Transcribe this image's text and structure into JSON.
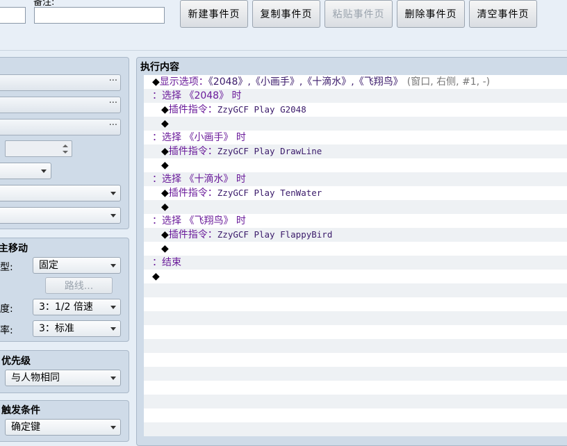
{
  "header": {
    "note_label": "备注:",
    "name_value": "",
    "note_value": "",
    "buttons": {
      "new_page": "新建事件页",
      "copy_page": "复制事件页",
      "paste_page": "粘贴事件页",
      "delete_page": "删除事件页",
      "clear_page": "清空事件页"
    }
  },
  "left": {
    "autonomous_movement": {
      "title": "主移动",
      "type_label": "型:",
      "type_value": "固定",
      "route_button": "路线...",
      "speed_label": "度:",
      "speed_value": "3：1/2 倍速",
      "freq_label": "率:",
      "freq_value": "3：标准"
    },
    "priority": {
      "title": "优先级",
      "value": "与人物相同"
    },
    "trigger": {
      "title": "触发条件",
      "value": "确定键"
    }
  },
  "content": {
    "title": "执行内容",
    "rows": [
      {
        "marker": "◆",
        "cmd": "显示选项：",
        "args": "《2048》,《小画手》,《十滴水》,《飞翔鸟》",
        "extra": "(窗口, 右侧, #1, -)"
      },
      {
        "marker": "：",
        "cmd": "选择 《2048》 时"
      },
      {
        "marker": "◆",
        "cmd": "插件指令：",
        "args": "ZzyGCF Play G2048"
      },
      {
        "marker": "◆"
      },
      {
        "marker": "：",
        "cmd": "选择 《小画手》 时"
      },
      {
        "marker": "◆",
        "cmd": "插件指令：",
        "args": "ZzyGCF Play DrawLine"
      },
      {
        "marker": "◆"
      },
      {
        "marker": "：",
        "cmd": "选择 《十滴水》 时"
      },
      {
        "marker": "◆",
        "cmd": "插件指令：",
        "args": "ZzyGCF Play TenWater"
      },
      {
        "marker": "◆"
      },
      {
        "marker": "：",
        "cmd": "选择 《飞翔鸟》 时"
      },
      {
        "marker": "◆",
        "cmd": "插件指令：",
        "args": "ZzyGCF Play FlappyBird"
      },
      {
        "marker": "◆"
      },
      {
        "marker": "：",
        "cmd": "结束"
      },
      {
        "marker": "◆"
      }
    ]
  }
}
